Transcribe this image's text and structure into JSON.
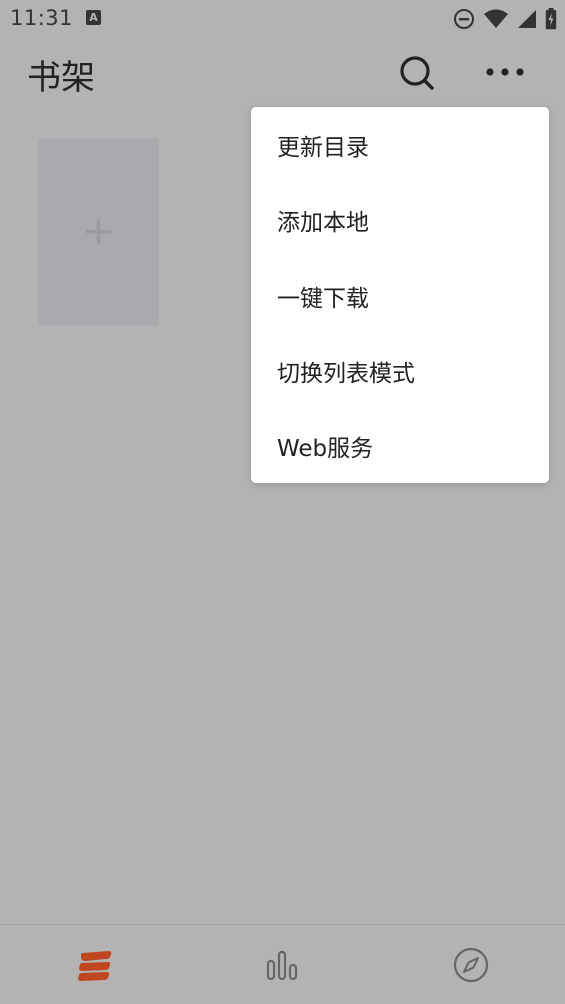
{
  "status_bar": {
    "time": "11:31",
    "notification_icon": "a-letter-icon",
    "icons": [
      "do-not-disturb-icon",
      "wifi-icon",
      "signal-icon",
      "battery-icon"
    ]
  },
  "toolbar": {
    "title": "书架",
    "search_icon": "search-icon",
    "more_icon": "more-horizontal-icon"
  },
  "shelf": {
    "add_icon": "plus-icon"
  },
  "menu": {
    "items": [
      {
        "label": "更新目录"
      },
      {
        "label": "添加本地"
      },
      {
        "label": "一键下载"
      },
      {
        "label": "切换列表模式"
      },
      {
        "label": "Web服务"
      }
    ]
  },
  "bottom_nav": {
    "items": [
      {
        "icon": "bookshelf-icon",
        "active": true
      },
      {
        "icon": "bar-chart-icon",
        "active": false
      },
      {
        "icon": "compass-icon",
        "active": false
      }
    ],
    "active_color": "#c0461f"
  },
  "colors": {
    "overlay_bg": "#b3b3b3",
    "menu_bg": "#ffffff",
    "accent": "#c0461f"
  }
}
